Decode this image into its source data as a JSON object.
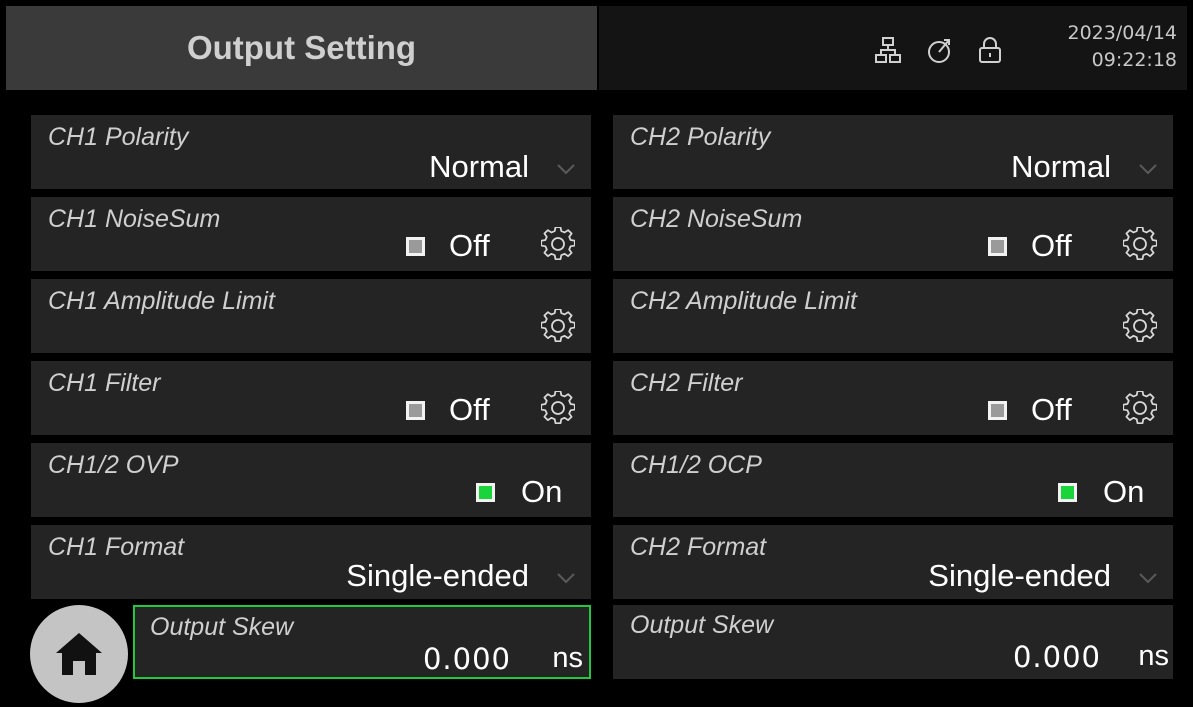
{
  "header": {
    "title": "Output Setting",
    "date": "2023/04/14",
    "time": "09:22:18",
    "icons": [
      "network-icon",
      "timer-icon",
      "lock-icon"
    ]
  },
  "rows": [
    {
      "left": {
        "label": "CH1 Polarity",
        "value": "Normal",
        "control": "dropdown"
      },
      "right": {
        "label": "CH2 Polarity",
        "value": "Normal",
        "control": "dropdown"
      }
    },
    {
      "left": {
        "label": "CH1 NoiseSum",
        "value": "Off",
        "checked": false,
        "control": "checkbox+settings"
      },
      "right": {
        "label": "CH2 NoiseSum",
        "value": "Off",
        "checked": false,
        "control": "checkbox+settings"
      }
    },
    {
      "left": {
        "label": "CH1 Amplitude Limit",
        "control": "settings"
      },
      "right": {
        "label": "CH2 Amplitude Limit",
        "control": "settings"
      }
    },
    {
      "left": {
        "label": "CH1 Filter",
        "value": "Off",
        "checked": false,
        "control": "checkbox+settings"
      },
      "right": {
        "label": "CH2 Filter",
        "value": "Off",
        "checked": false,
        "control": "checkbox+settings"
      }
    },
    {
      "left": {
        "label": "CH1/2 OVP",
        "value": "On",
        "checked": true,
        "control": "checkbox"
      },
      "right": {
        "label": "CH1/2 OCP",
        "value": "On",
        "checked": true,
        "control": "checkbox"
      }
    },
    {
      "left": {
        "label": "CH1 Format",
        "value": "Single-ended",
        "control": "dropdown"
      },
      "right": {
        "label": "CH2 Format",
        "value": "Single-ended",
        "control": "dropdown"
      }
    },
    {
      "left": {
        "label": "Output Skew",
        "value": "0.000",
        "unit": "ns",
        "control": "numeric",
        "focused": true
      },
      "right": {
        "label": "Output Skew",
        "value": "0.000",
        "unit": "ns",
        "control": "numeric"
      }
    }
  ],
  "colors": {
    "on": "#19d43a",
    "off": "#9a9a9a",
    "focus": "#22c93a",
    "panel": "#242424"
  }
}
